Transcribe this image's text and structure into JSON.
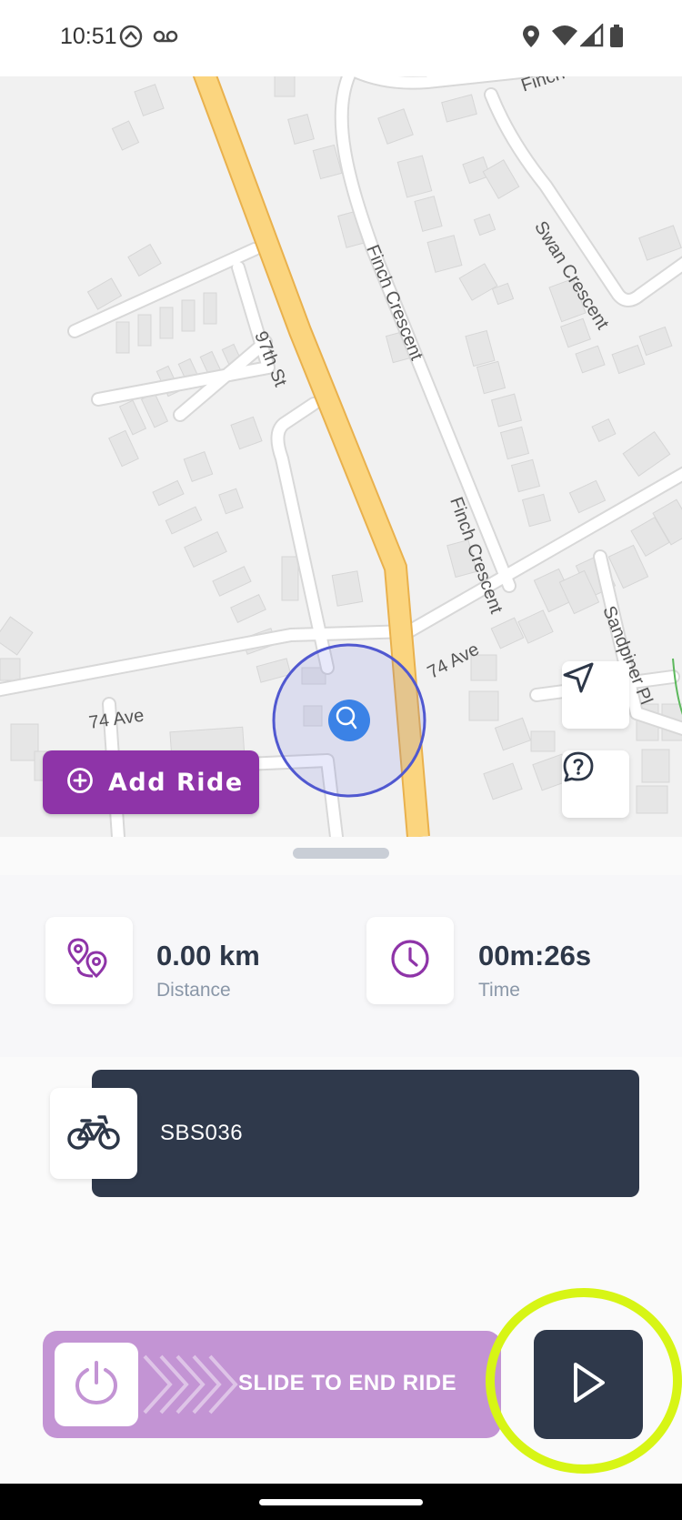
{
  "status_bar": {
    "time": "10:51",
    "icons": [
      "android-auto-icon",
      "voicemail-icon",
      "location-icon",
      "wifi-icon",
      "signal-icon",
      "battery-icon"
    ]
  },
  "map": {
    "street_labels": [
      "Finch Crescent",
      "Finch Crescent",
      "Swan Crescent",
      "97th St",
      "74 Ave",
      "74 Ave",
      "Sandpiper Pl",
      "Finch"
    ],
    "recenter_icon": "navigation-arrow-icon",
    "help_icon": "help-bubble-icon"
  },
  "add_ride": {
    "icon": "plus-circle-icon",
    "label": "Add Ride"
  },
  "stats": {
    "distance": {
      "icon": "route-pins-icon",
      "value": "0.00 km",
      "label": "Distance"
    },
    "time": {
      "icon": "clock-icon",
      "value": "00m:26s",
      "label": "Time"
    }
  },
  "bike": {
    "icon": "bicycle-icon",
    "id": "SBS036"
  },
  "end_ride": {
    "icon": "power-icon",
    "label": "SLIDE TO END RIDE",
    "play_icon": "play-icon"
  },
  "colors": {
    "primary_purple": "#8e34a8",
    "slider_purple": "#c394d4",
    "dark_navy": "#2f394b",
    "highlight": "#d7f515",
    "location_blue": "#3b82e6"
  }
}
